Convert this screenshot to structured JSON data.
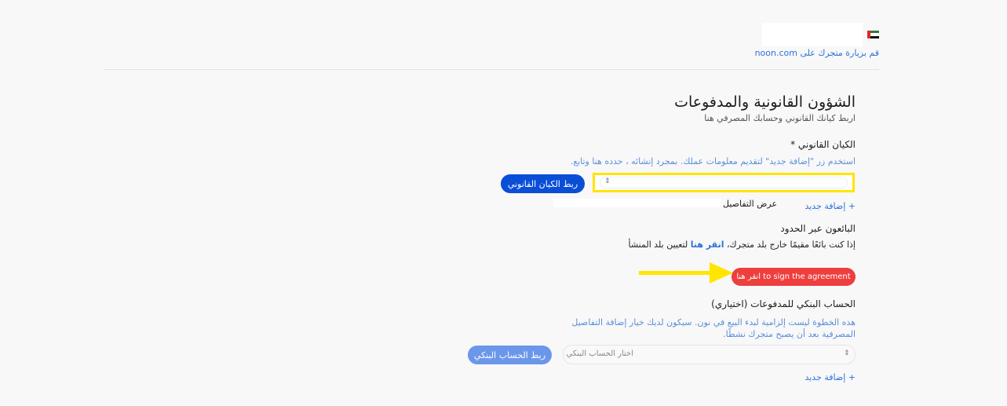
{
  "header": {
    "visit_store_link": "قم بزيارة متجرك على noon.com"
  },
  "page": {
    "title": "الشؤون القانونية والمدفوعات",
    "subtitle": "اربط كيانك القانوني وحسابك المصرفي هنا"
  },
  "legal_entity": {
    "label": "الكيان القانوني *",
    "hint": "استخدم زر \"إضافة جديد\" لتقديم معلومات عملك. بمجرد إنشائه ، حدده هنا وتابع.",
    "select_icon": "chevron-updown-icon",
    "link_button": "ربط الكيان القانوني",
    "add_new": "+ إضافة جديد",
    "view_details": "عرض التفاصيل"
  },
  "cross_border": {
    "label": "البائعون عبر الحدود",
    "text_before": "إذا كنت بائعًا مقيمًا خارج بلد متجرك، ",
    "click_here": "انقر هنا",
    "text_after": " لتعيين بلد المنشأ",
    "sign_button": "انقر هنا to sign the agreement"
  },
  "bank_account": {
    "label": "الحساب البنكي للمدفوعات (اختياري)",
    "hint": "هذه الخطوة ليست إلزامية لبدء البيع في نون. سيكون لديك خيار إضافة التفاصيل المصرفية بعد أن يصبح متجرك نشطًا.",
    "select_placeholder": "اختار الحساب البنكي",
    "link_button": "ربط الحساب البنكي",
    "add_new": "+ إضافة جديد"
  },
  "colors": {
    "primary_blue": "#0a4ed8",
    "link_blue": "#2b72d9",
    "red_button": "#ee3e3e",
    "highlight_yellow": "#ffe500"
  }
}
